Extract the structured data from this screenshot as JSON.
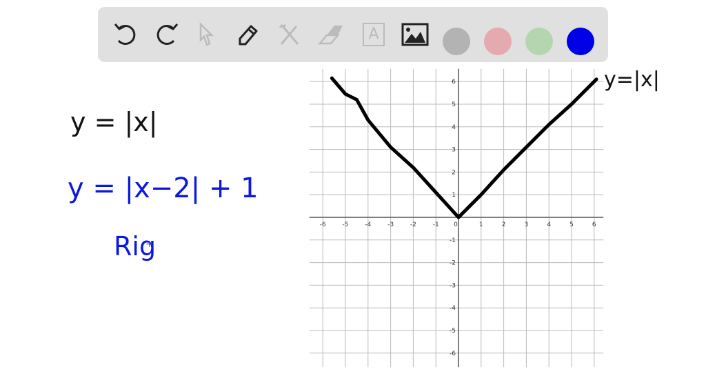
{
  "toolbar": {
    "tools": [
      {
        "name": "undo-icon"
      },
      {
        "name": "redo-icon"
      },
      {
        "name": "select-pointer-icon"
      },
      {
        "name": "pen-icon"
      },
      {
        "name": "tools-icon"
      },
      {
        "name": "eraser-icon"
      },
      {
        "name": "text-icon",
        "label": "A"
      },
      {
        "name": "image-icon"
      }
    ],
    "colors": [
      "#b3b3b3",
      "#e5aab0",
      "#b5d5b0",
      "#0000e6"
    ]
  },
  "notes": {
    "line1": "y = |x|",
    "line2": "y = |x−2| + 1",
    "line3": "Rig",
    "graph_label": "y=|x|"
  },
  "chart_data": {
    "type": "line",
    "title": "",
    "xlabel": "",
    "ylabel": "",
    "xlim": [
      -6.5,
      6.5
    ],
    "ylim": [
      -6.5,
      6.5
    ],
    "grid": true,
    "x_ticks": [
      "-6",
      "-5",
      "-4",
      "-3",
      "-2",
      "-1",
      "0",
      "1",
      "2",
      "3",
      "4",
      "5",
      "6"
    ],
    "y_ticks": [
      "6",
      "5",
      "4",
      "3",
      "2",
      "1",
      "-1",
      "-2",
      "-3",
      "-4",
      "-5",
      "-6"
    ],
    "series": [
      {
        "name": "y=|x|",
        "color": "#000000",
        "x": [
          -5.6,
          -5,
          -4.5,
          -4,
          -3,
          -2,
          -1,
          0,
          1,
          2,
          3,
          4,
          5,
          6.1
        ],
        "y": [
          6.15,
          5.45,
          5.2,
          4.3,
          3.1,
          2.2,
          1.1,
          0,
          1.0,
          2.1,
          3.1,
          4.1,
          5.0,
          6.1
        ]
      }
    ]
  }
}
